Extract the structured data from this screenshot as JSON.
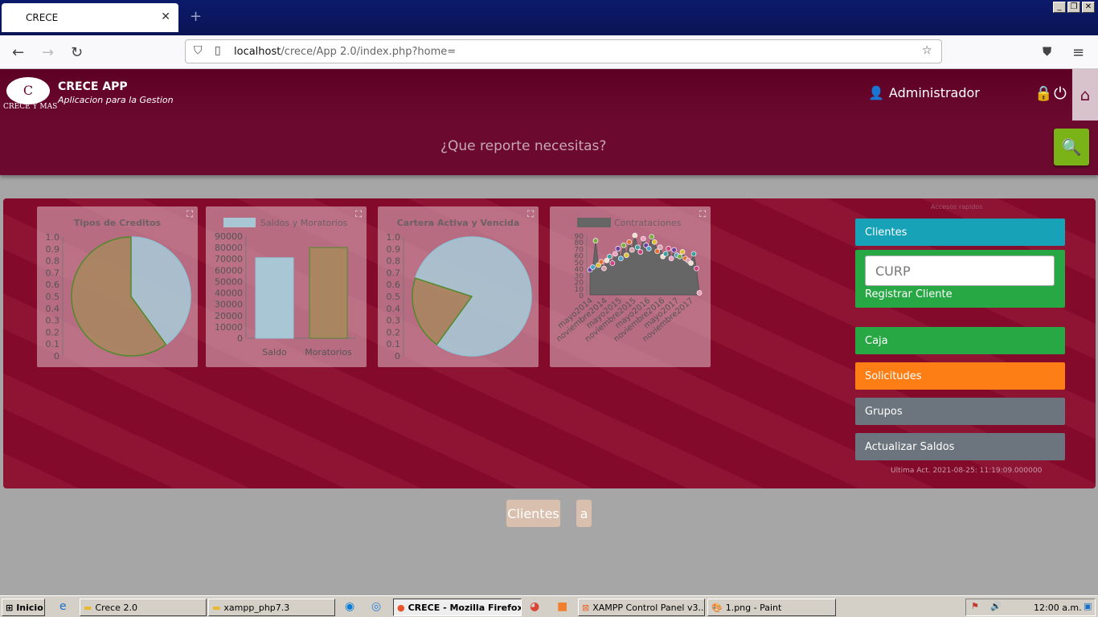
{
  "browser": {
    "tab_title": "CRECE",
    "url_host": "localhost",
    "url_path": "/crece/App 2.0/index.php?home="
  },
  "header": {
    "logo_text": "C",
    "logo_sub": "CRECE Y MAS",
    "app_title": "CRECE APP",
    "app_subtitle": "Aplicacion para la Gestion",
    "user_name": "Administrador"
  },
  "search": {
    "placeholder": "¿Que reporte necesitas?"
  },
  "colors": {
    "primary": "#6b0a2e",
    "panel": "#8a0a2c",
    "accent_green": "#7ab317"
  },
  "sidebar": {
    "caption": "Accesos rapidos",
    "buttons": {
      "clientes": "Clientes",
      "caja": "Caja",
      "solicitudes": "Solicitudes",
      "grupos": "Grupos",
      "actualizar": "Actualizar Saldos"
    },
    "curp_placeholder": "CURP",
    "registrar": "Registrar Cliente",
    "last_update": "Ultima Act. 2021-08-25: 11:19:09.000000"
  },
  "pills": {
    "clientes": "Clientes",
    "a": "a"
  },
  "chart_data": [
    {
      "type": "pie",
      "title": "Tipos de Creditos",
      "ylim": [
        0,
        1.0
      ],
      "yticks": [
        "1.0",
        "0.9",
        "0.8",
        "0.7",
        "0.6",
        "0.5",
        "0.4",
        "0.3",
        "0.2",
        "0.1",
        "0"
      ],
      "slices": [
        {
          "value": 0.4,
          "color": "#a9c6d4"
        },
        {
          "value": 0.6,
          "color": "#a98661"
        }
      ]
    },
    {
      "type": "bar",
      "series_label": "Saldos y Moratorios",
      "categories": [
        "Saldo",
        "Moratorios"
      ],
      "values": [
        71000,
        80000
      ],
      "colors": [
        "#a9c6d4",
        "#a98661"
      ],
      "ylim": [
        0,
        90000
      ],
      "yticks": [
        "90000",
        "80000",
        "70000",
        "60000",
        "50000",
        "40000",
        "30000",
        "20000",
        "10000",
        "0"
      ]
    },
    {
      "type": "pie",
      "title": "Cartera Activa y Vencida",
      "ylim": [
        0,
        1.0
      ],
      "yticks": [
        "1.0",
        "0.9",
        "0.8",
        "0.7",
        "0.6",
        "0.5",
        "0.4",
        "0.3",
        "0.2",
        "0.1",
        "0"
      ],
      "slices": [
        {
          "value": 0.8,
          "color": "#a9c6d4"
        },
        {
          "value": 0.2,
          "color": "#a98661"
        }
      ]
    },
    {
      "type": "area",
      "series_label": "Contrataciones",
      "ylim": [
        0,
        90
      ],
      "yticks": [
        "90",
        "80",
        "70",
        "60",
        "50",
        "40",
        "30",
        "20",
        "10",
        "0"
      ],
      "xticks": [
        "mayo2014",
        "noviembre2014",
        "mayo2015",
        "noviembre2015",
        "mayo2016",
        "noviembre2016",
        "mayo2017",
        "noviembre2017"
      ],
      "values": [
        38,
        42,
        82,
        45,
        50,
        40,
        52,
        58,
        48,
        62,
        70,
        55,
        75,
        60,
        80,
        68,
        90,
        72,
        65,
        85,
        75,
        70,
        88,
        80,
        66,
        72,
        58,
        62,
        70,
        55,
        68,
        60,
        58,
        65,
        55,
        52,
        48,
        62,
        40,
        3
      ]
    }
  ]
}
